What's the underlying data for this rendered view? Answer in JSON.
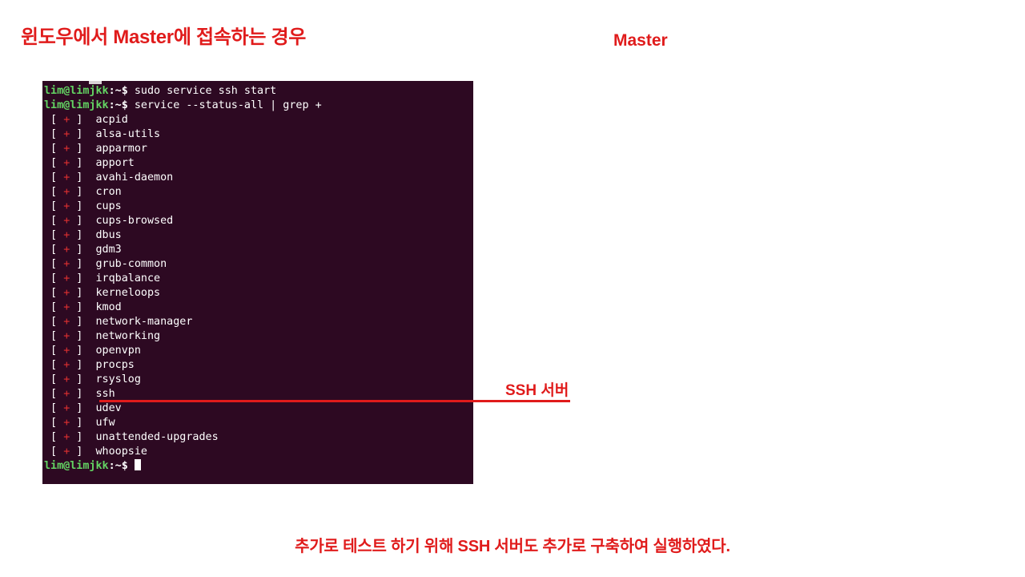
{
  "slide": {
    "title": "윈도우에서 Master에 접속하는 경우",
    "master_label": "Master",
    "caption": "추가로 테스트 하기 위해 SSH 서버도 추가로 구축하여 실행하였다."
  },
  "annotation": {
    "ssh_label": "SSH 서버",
    "line_color": "#e01b1b"
  },
  "terminal": {
    "background": "#2d0922",
    "prompt_user_color": "#63d463",
    "prompt_user": "lim@limjkk",
    "prompt_path": ":~$",
    "commands": [
      "sudo service ssh start",
      "service --status-all | grep +"
    ],
    "status_mark_open": "[",
    "status_mark_plus": "+",
    "status_mark_close": "]",
    "services": [
      "acpid",
      "alsa-utils",
      "apparmor",
      "apport",
      "avahi-daemon",
      "cron",
      "cups",
      "cups-browsed",
      "dbus",
      "gdm3",
      "grub-common",
      "irqbalance",
      "kerneloops",
      "kmod",
      "network-manager",
      "networking",
      "openvpn",
      "procps",
      "rsyslog",
      "ssh",
      "udev",
      "ufw",
      "unattended-upgrades",
      "whoopsie"
    ]
  }
}
